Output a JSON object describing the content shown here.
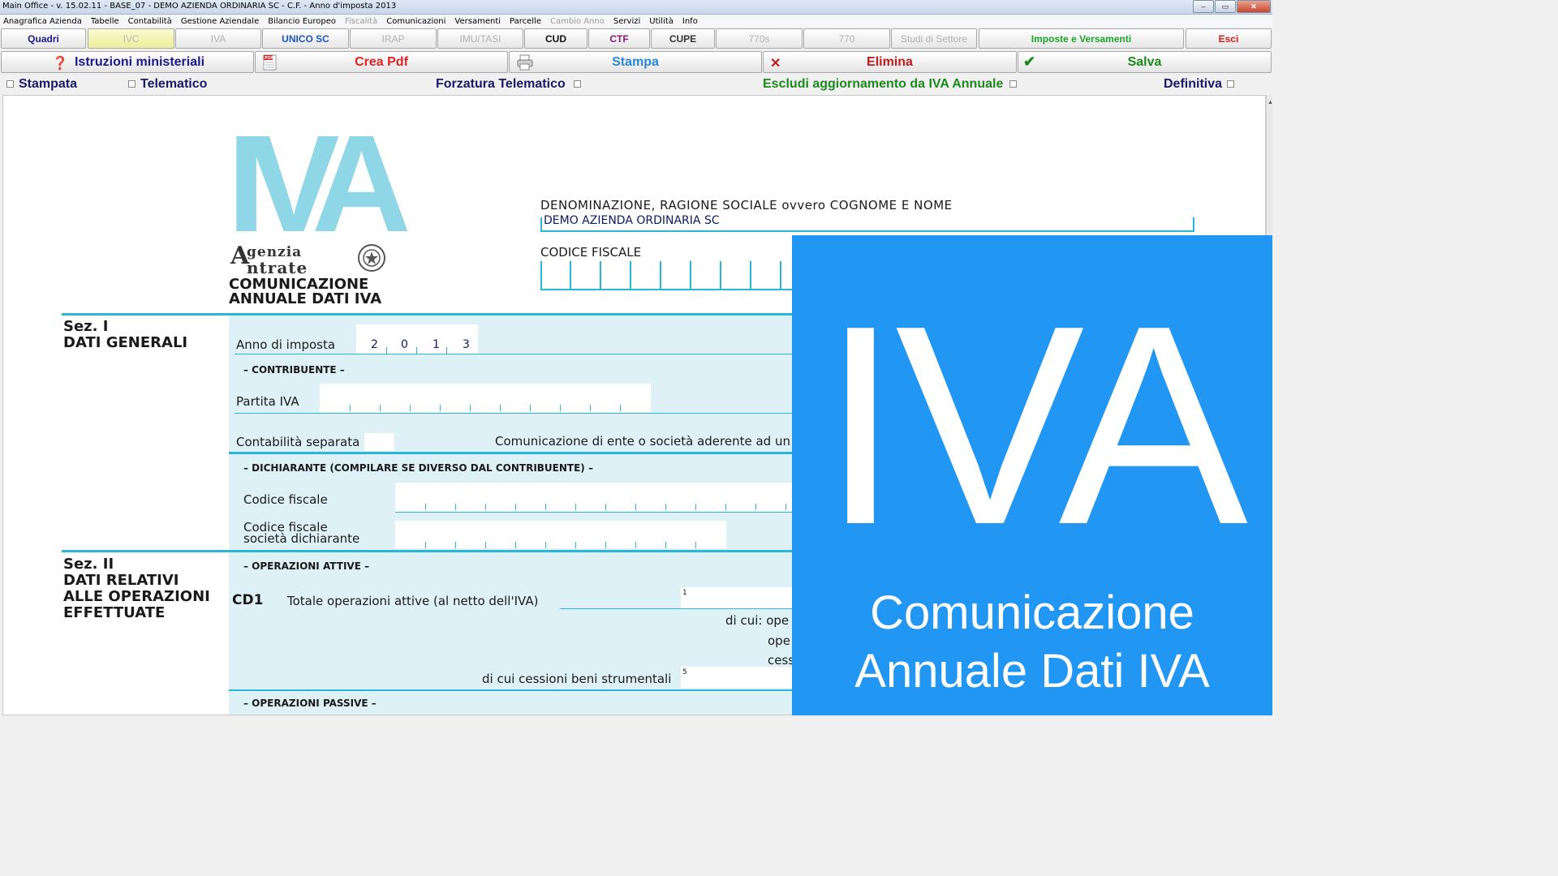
{
  "window": {
    "title": "Main Office - v. 15.02.11 - BASE_07 - DEMO AZIENDA ORDINARIA SC - C.F.  - Anno d'imposta 2013",
    "buttons": [
      "‒",
      "▭",
      "✕"
    ]
  },
  "menu": [
    {
      "label": "Anagrafica Azienda",
      "disabled": false
    },
    {
      "label": "Tabelle",
      "disabled": false
    },
    {
      "label": "Contabilità",
      "disabled": false
    },
    {
      "label": "Gestione Aziendale",
      "disabled": false
    },
    {
      "label": "Bilancio Europeo",
      "disabled": false
    },
    {
      "label": "Fiscalità",
      "disabled": true
    },
    {
      "label": "Comunicazioni",
      "disabled": false
    },
    {
      "label": "Versamenti",
      "disabled": false
    },
    {
      "label": "Parcelle",
      "disabled": false
    },
    {
      "label": "Cambio Anno",
      "disabled": true
    },
    {
      "label": "Servizi",
      "disabled": false
    },
    {
      "label": "Utilità",
      "disabled": false
    },
    {
      "label": "Info",
      "disabled": false
    }
  ],
  "tabs": [
    {
      "label": "Quadri",
      "color": "#1a1a8c",
      "active": false
    },
    {
      "label": "IVC",
      "color": "#b9b9b9",
      "active": true
    },
    {
      "label": "IVA",
      "color": "#b0b0b0",
      "active": false
    },
    {
      "label": "UNICO SC",
      "color": "#1a56c8",
      "active": false
    },
    {
      "label": "IRAP",
      "color": "#b0b0b0",
      "active": false
    },
    {
      "label": "IMU/TASI",
      "color": "#b0b0b0",
      "active": false
    },
    {
      "label": "CUD",
      "color": "#111111",
      "active": false
    },
    {
      "label": "CTF",
      "color": "#8b1a7a",
      "active": false
    },
    {
      "label": "CUPE",
      "color": "#333333",
      "active": false
    },
    {
      "label": "770s",
      "color": "#b0b0b0",
      "active": false
    },
    {
      "label": "770",
      "color": "#b0b0b0",
      "active": false
    },
    {
      "label": "Studi di Settore",
      "color": "#b0b0b0",
      "active": false
    },
    {
      "label": "Imposte e Versamenti",
      "color": "#1aa52a",
      "active": false
    },
    {
      "label": "Esci",
      "color": "#d21a1a",
      "active": false
    }
  ],
  "actions": {
    "istruzioni": {
      "label": "Istruzioni ministeriali",
      "color": "#1a1a8c"
    },
    "pdf": {
      "label": "Crea Pdf",
      "color": "#e02222"
    },
    "stampa": {
      "label": "Stampa",
      "color": "#2a86d6"
    },
    "elimina": {
      "label": "Elimina",
      "color": "#c21a1a"
    },
    "salva": {
      "label": "Salva",
      "color": "#1c8a1c"
    }
  },
  "checks": {
    "stampata": "Stampata",
    "telematico": "Telematico",
    "forzatura": "Forzatura Telematico",
    "escludi": "Escludi aggiornamento da IVA Annuale",
    "definitiva": "Definitiva"
  },
  "form": {
    "logo_letters": "IVA",
    "agency_line1": "genzia",
    "agency_line2": "ntrate",
    "comunicazione_line1": "COMUNICAZIONE",
    "comunicazione_line2": "ANNUALE DATI IVA",
    "denominazione_label": "DENOMINAZIONE, RAGIONE SOCIALE ovvero COGNOME E NOME",
    "denominazione_value": "DEMO AZIENDA ORDINARIA SC",
    "codice_fiscale_label": "CODICE FISCALE",
    "sez1_title": "Sez. I",
    "sez1_sub": "DATI GENERALI",
    "anno_label": "Anno di imposta",
    "anno_digits": [
      "2",
      "0",
      "1",
      "3"
    ],
    "contribuente": "– CONTRIBUENTE –",
    "partita_iva": "Partita IVA",
    "contabilita": "Contabilità separata",
    "comunicazione_ente": "Comunicazione di ente o società aderente ad un g",
    "dichiarante": "– DICHIARANTE (COMPILARE SE DIVERSO DAL CONTRIBUENTE) –",
    "codice_fiscale": "Codice fiscale",
    "cf_soc_1": "Codice fiscale",
    "cf_soc_2": "società dichiarante",
    "sez2_title": "Sez. II",
    "sez2_l1": "DATI RELATIVI",
    "sez2_l2": "ALLE OPERAZIONI",
    "sez2_l3": "EFFETTUATE",
    "op_attive": "– OPERAZIONI ATTIVE –",
    "cd1": "CD1",
    "totale": "Totale operazioni attive (al netto dell'IVA)",
    "field1": "1",
    "dicui": "di cui: ope",
    "ope": "ope",
    "cess": "cess",
    "dicui_cessioni": "di cui cessioni beni strumentali",
    "field5": "5",
    "op_passive": "– OPERAZIONI PASSIVE –"
  },
  "overlay": {
    "big": "IVA",
    "line1": "Comunicazione",
    "line2": "Annuale Dati IVA",
    "color": "#2196f3"
  }
}
